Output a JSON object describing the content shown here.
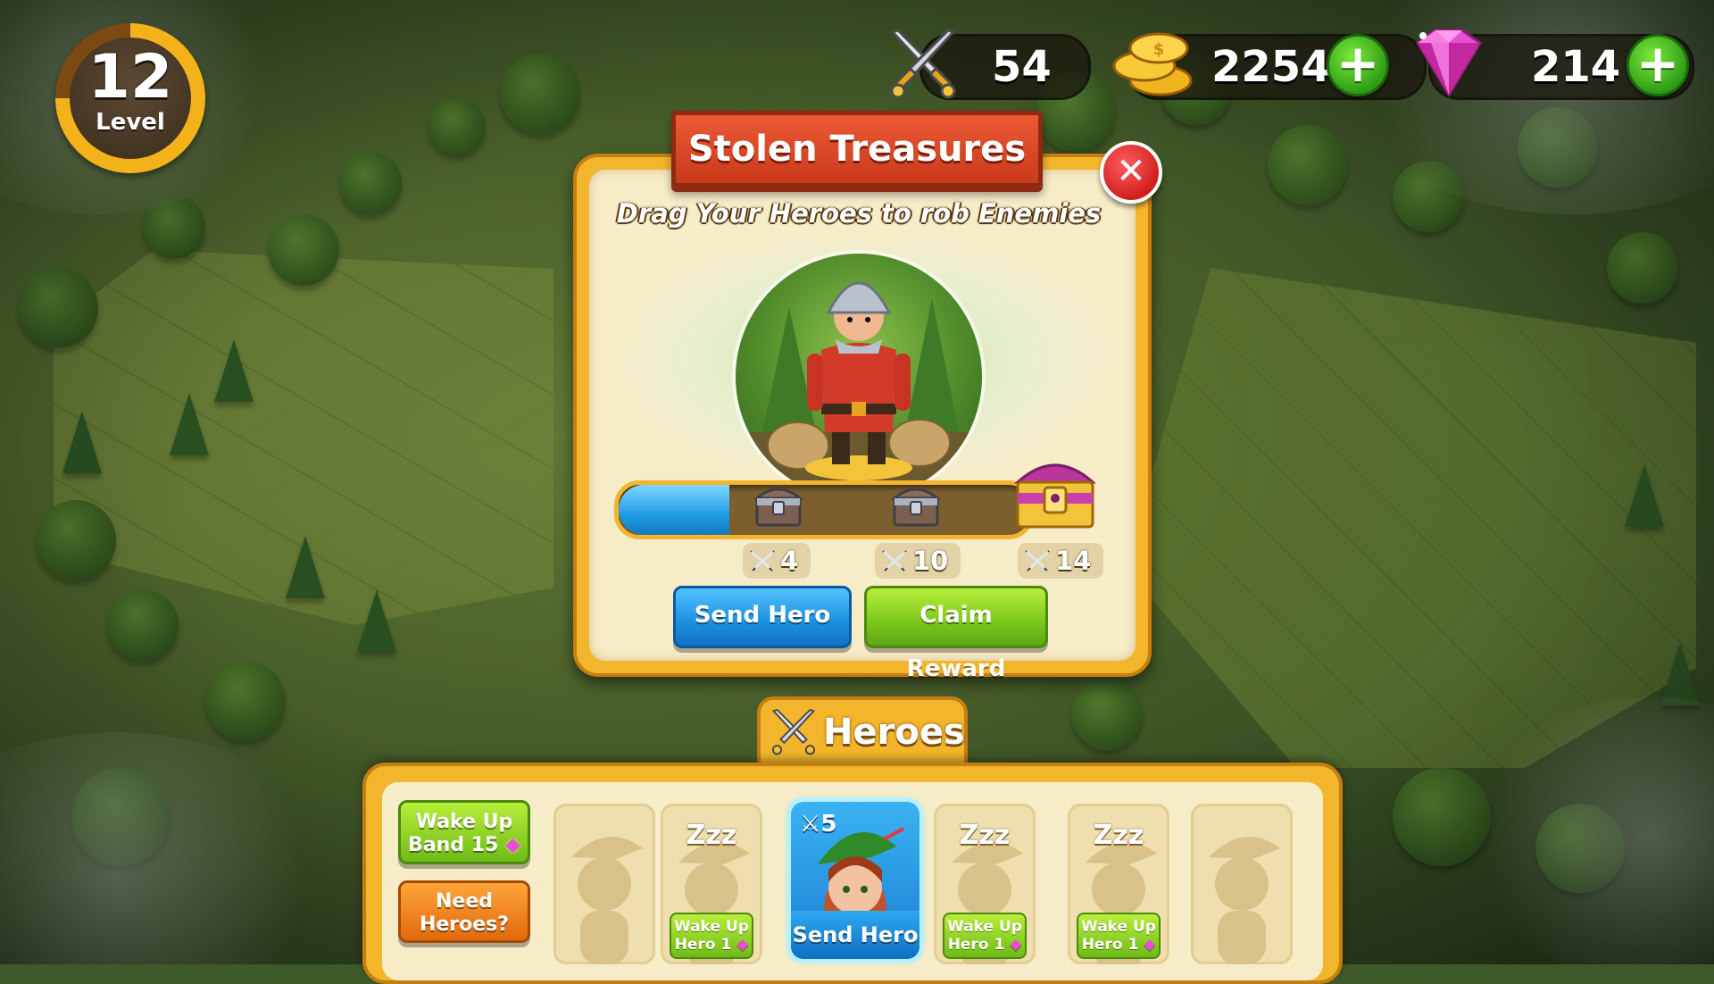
{
  "level": {
    "number": "12",
    "label": "Level",
    "progress_fraction": 0.75
  },
  "currencies": {
    "battle_power": {
      "value": "54",
      "icon": "crossed-swords-icon"
    },
    "coins": {
      "value": "2254",
      "icon": "gold-coins-icon",
      "add_icon": "plus-icon"
    },
    "gems": {
      "value": "214",
      "icon": "pink-gem-icon",
      "add_icon": "plus-icon"
    }
  },
  "popup": {
    "title": "Stolen Treasures",
    "subtitle": "Drag Your Heroes to rob Enemies",
    "enemy": "guard-portrait",
    "progress_fraction": 0.27,
    "milestones": [
      {
        "value": "4",
        "reward": "silver-chest-icon"
      },
      {
        "value": "10",
        "reward": "silver-chest-icon"
      },
      {
        "value": "14",
        "reward": "golden-chest-icon"
      }
    ],
    "send_button": "Send Hero",
    "claim_button": "Claim Reward"
  },
  "heroes": {
    "title": "Heroes",
    "wake_band_line1": "Wake Up",
    "wake_band_line2": "Band 15",
    "need_heroes_line1": "Need",
    "need_heroes_line2": "Heroes?",
    "cards": [
      {
        "state": "locked"
      },
      {
        "state": "sleeping",
        "zzz": "Zzz",
        "wake_line1": "Wake Up",
        "wake_line2": "Hero  1"
      },
      {
        "state": "ready",
        "power": "5",
        "action": "Send Hero"
      },
      {
        "state": "sleeping",
        "zzz": "Zzz",
        "wake_line1": "Wake Up",
        "wake_line2": "Hero  1"
      },
      {
        "state": "sleeping",
        "zzz": "Zzz",
        "wake_line1": "Wake Up",
        "wake_line2": "Hero  1"
      },
      {
        "state": "locked"
      }
    ]
  },
  "colors": {
    "accent_gold": "#f3b52b",
    "ribbon_red": "#d9431f",
    "button_blue": "#1b8fe0",
    "button_green": "#7ac61c",
    "gem_pink": "#e64fd0"
  }
}
